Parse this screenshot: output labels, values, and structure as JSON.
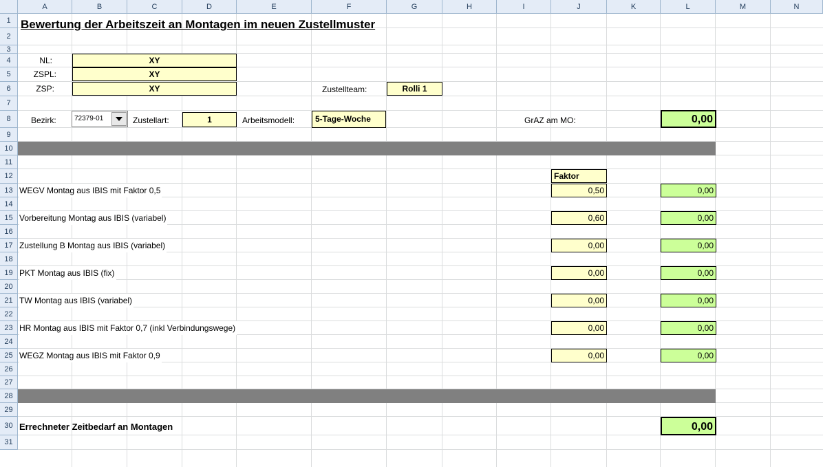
{
  "columns": [
    "A",
    "B",
    "C",
    "D",
    "E",
    "F",
    "G",
    "H",
    "I",
    "J",
    "K",
    "L",
    "M",
    "N"
  ],
  "rows": [
    "1",
    "2",
    "3",
    "4",
    "5",
    "6",
    "7",
    "8",
    "9",
    "10",
    "11",
    "12",
    "13",
    "14",
    "15",
    "16",
    "17",
    "18",
    "19",
    "20",
    "21",
    "22",
    "23",
    "24",
    "25",
    "26",
    "27",
    "28",
    "29",
    "30",
    "31"
  ],
  "title": "Bewertung der Arbeitszeit an Montagen im neuen Zustellmuster",
  "header_fields": {
    "nl_label": "NL:",
    "nl_value": "XY",
    "zspl_label": "ZSPL:",
    "zspl_value": "XY",
    "zsp_label": "ZSP:",
    "zsp_value": "XY",
    "zustellteam_label": "Zustellteam:",
    "zustellteam_value": "Rolli 1",
    "bezirk_label": "Bezirk:",
    "bezirk_value": "72379-01",
    "zustellart_label": "Zustellart:",
    "zustellart_value": "1",
    "arbeitsmodell_label": "Arbeitsmodell:",
    "arbeitsmodell_value": "5-Tage-Woche",
    "graz_label": "GrAZ am MO:",
    "graz_value": "0,00"
  },
  "faktor_header": "Faktor",
  "items": [
    {
      "label": "WEGV Montag aus IBIS mit Faktor 0,5",
      "faktor": "0,50",
      "result": "0,00"
    },
    {
      "label": "Vorbereitung Montag aus IBIS (variabel)",
      "faktor": "0,60",
      "result": "0,00"
    },
    {
      "label": "Zustellung B Montag aus IBIS (variabel)",
      "faktor": "0,00",
      "result": "0,00"
    },
    {
      "label": "PKT Montag aus IBIS (fix)",
      "faktor": "0,00",
      "result": "0,00"
    },
    {
      "label": "TW Montag aus IBIS (variabel)",
      "faktor": "0,00",
      "result": "0,00"
    },
    {
      "label": "HR Montag aus IBIS mit Faktor 0,7 (inkl Verbindungswege)",
      "faktor": "0,00",
      "result": "0,00"
    },
    {
      "label": "WEGZ Montag aus IBIS mit Faktor 0,9",
      "faktor": "0,00",
      "result": "0,00"
    }
  ],
  "total_label": "Errechneter Zeitbedarf an Montagen",
  "total_value": "0,00",
  "colors": {
    "yellow": "#ffffcc",
    "green": "#ccff99",
    "bar": "#808080",
    "header": "#e4ecf7"
  }
}
